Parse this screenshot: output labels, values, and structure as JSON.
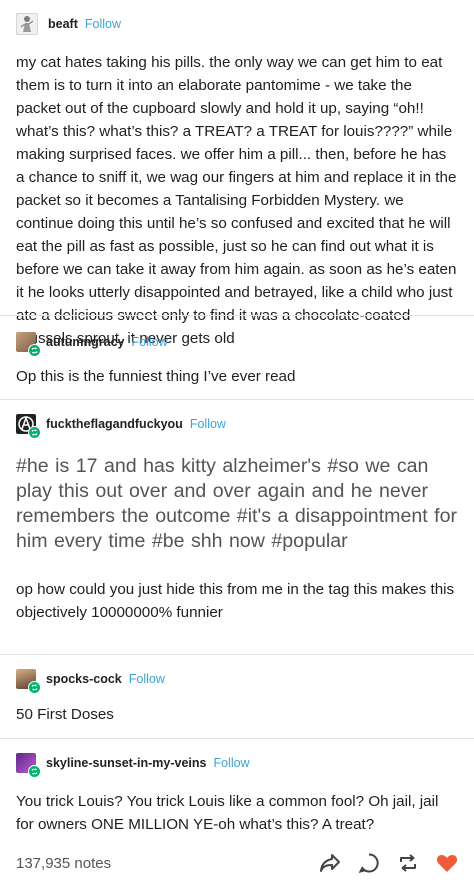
{
  "posts": [
    {
      "username": "beaft",
      "follow": "Follow",
      "avatar_icon": "cat-figure-avatar",
      "text": "my cat hates taking his pills. the only way we can get him to eat them is to turn it into an elaborate pantomime - we take the packet out of the cupboard slowly and hold it up, saying “oh!! what’s this? what’s this? a TREAT? a TREAT for louis????” while making surprised faces. we offer him a pill... then, before he has a chance to sniff it, we wag our fingers at him and replace it in the packet so it becomes a Tantalising Forbidden Mystery. we continue doing this until he’s so confused and excited that he will eat the pill as fast as possible, just so he can find out what it is before we can take it away from him again. as soon as he’s eaten it he looks utterly disappointed and betrayed, like a child who just ate a delicious sweet only to find it was a chocolate-coated brussels sprout. it never gets old"
    },
    {
      "username": "autumngracy",
      "follow": "Follow",
      "text": "Op this is the funniest thing I’ve ever read"
    },
    {
      "username": "fucktheflagandfuckyou",
      "follow": "Follow",
      "tags": "#he is 17 and has kitty alzheimer's  #so we can play this out over and over again and he never remembers the outcome  #it's a disappointment for him every time  #be shh now  #popular",
      "text": "op how could you just hide this from me in the tag this makes this objectively 10000000% funnier"
    },
    {
      "username": "spocks-cock",
      "follow": "Follow",
      "text": "50 First Doses"
    },
    {
      "username": "skyline-sunset-in-my-veins",
      "follow": "Follow",
      "text": "You trick Louis? You trick Louis like a common fool? Oh jail, jail for owners ONE MILLION YE-oh what’s this? A treat?"
    }
  ],
  "footer": {
    "notes": "137,935 notes",
    "icons": [
      "share-icon",
      "reply-icon",
      "reblog-icon",
      "like-icon"
    ]
  },
  "colors": {
    "follow": "#3aa3d8",
    "reblog_badge": "#00b36b",
    "like": "#f15a3a",
    "divider": "#e3e3e3"
  }
}
